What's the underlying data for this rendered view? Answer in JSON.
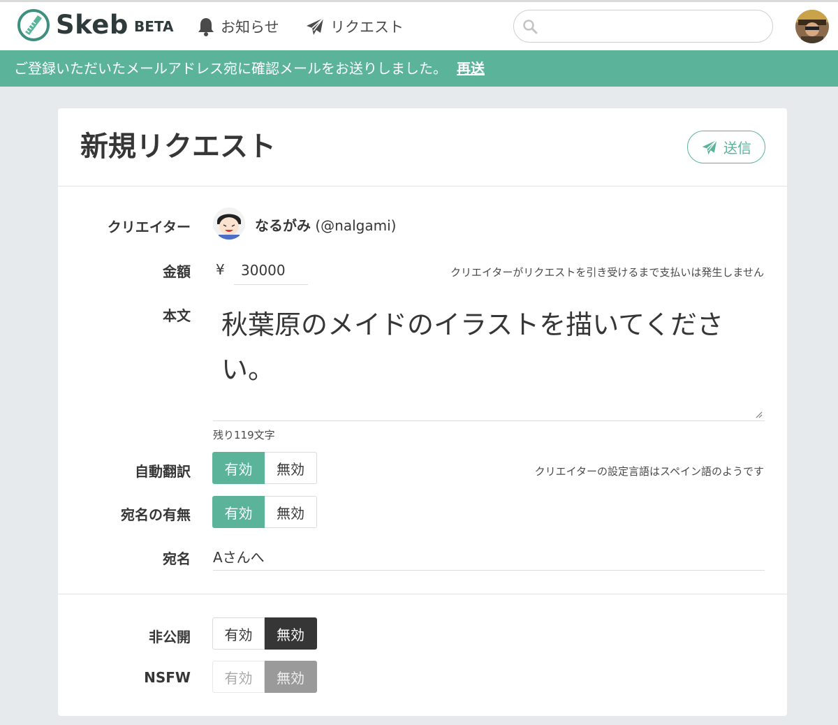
{
  "navbar": {
    "logo_text": "Skeb",
    "beta_label": "BETA",
    "notice_label": "お知らせ",
    "request_label": "リクエスト",
    "search_placeholder": ""
  },
  "notice_bar": {
    "message": "ご登録いただいたメールアドレス宛に確認メールをお送りしました。",
    "resend_label": "再送"
  },
  "form": {
    "title": "新規リクエスト",
    "send_label": "送信",
    "creator": {
      "label": "クリエイター",
      "name": "なるがみ",
      "handle": "(@nalgami)"
    },
    "amount": {
      "label": "金額",
      "currency": "¥",
      "value": "30000",
      "hint": "クリエイターがリクエストを引き受けるまで支払いは発生しません"
    },
    "body": {
      "label": "本文",
      "value": "秋葉原のメイドのイラストを描いてください。",
      "remaining": "残り119文字"
    },
    "auto_translate": {
      "label": "自動翻訳",
      "on_label": "有効",
      "off_label": "無効",
      "selected": "有効",
      "hint": "クリエイターの設定言語はスペイン語のようです"
    },
    "addressee_toggle": {
      "label": "宛名の有無",
      "on_label": "有効",
      "off_label": "無効",
      "selected": "有効"
    },
    "addressee": {
      "label": "宛名",
      "value": "Aさんへ"
    },
    "private": {
      "label": "非公開",
      "on_label": "有効",
      "off_label": "無効",
      "selected": "無効"
    },
    "nsfw": {
      "label": "NSFW",
      "on_label": "有効",
      "off_label": "無効",
      "selected": "無効"
    }
  },
  "colors": {
    "brand_green": "#5bb49a",
    "dark": "#363636",
    "background": "#e6eaed"
  }
}
